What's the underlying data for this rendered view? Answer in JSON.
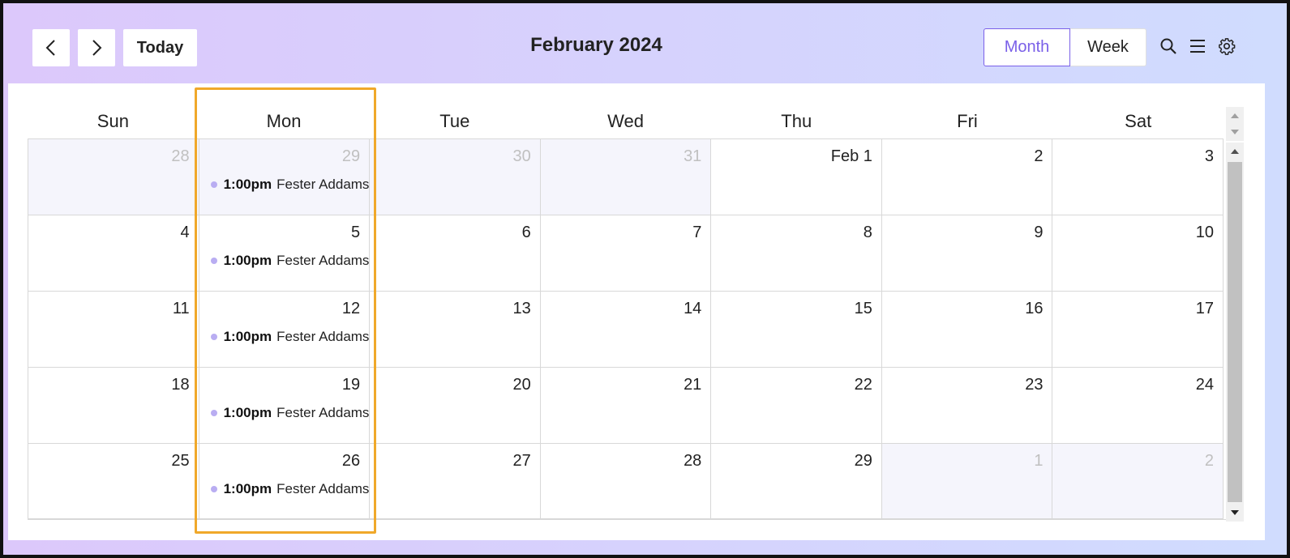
{
  "header": {
    "title": "February 2024",
    "today_label": "Today",
    "views": [
      "Month",
      "Week"
    ],
    "active_view": "Month"
  },
  "colors": {
    "accent": "#7a60e8",
    "event_dot": "#b9adf2",
    "highlight": "#f0a82a"
  },
  "icons": [
    "chevron-left-icon",
    "chevron-right-icon",
    "search-icon",
    "menu-icon",
    "gear-icon"
  ],
  "calendar": {
    "weekdays": [
      "Sun",
      "Mon",
      "Tue",
      "Wed",
      "Thu",
      "Fri",
      "Sat"
    ],
    "weeks": [
      {
        "days": [
          {
            "label": "28",
            "other": true
          },
          {
            "label": "29",
            "other": true
          },
          {
            "label": "30",
            "other": true
          },
          {
            "label": "31",
            "other": true
          },
          {
            "label": "Feb 1",
            "other": false
          },
          {
            "label": "2",
            "other": false
          },
          {
            "label": "3",
            "other": false
          }
        ]
      },
      {
        "days": [
          {
            "label": "4",
            "other": false
          },
          {
            "label": "5",
            "other": false
          },
          {
            "label": "6",
            "other": false
          },
          {
            "label": "7",
            "other": false
          },
          {
            "label": "8",
            "other": false
          },
          {
            "label": "9",
            "other": false
          },
          {
            "label": "10",
            "other": false
          }
        ]
      },
      {
        "days": [
          {
            "label": "11",
            "other": false
          },
          {
            "label": "12",
            "other": false
          },
          {
            "label": "13",
            "other": false
          },
          {
            "label": "14",
            "other": false
          },
          {
            "label": "15",
            "other": false
          },
          {
            "label": "16",
            "other": false
          },
          {
            "label": "17",
            "other": false
          }
        ]
      },
      {
        "days": [
          {
            "label": "18",
            "other": false
          },
          {
            "label": "19",
            "other": false
          },
          {
            "label": "20",
            "other": false
          },
          {
            "label": "21",
            "other": false
          },
          {
            "label": "22",
            "other": false
          },
          {
            "label": "23",
            "other": false
          },
          {
            "label": "24",
            "other": false
          }
        ]
      },
      {
        "days": [
          {
            "label": "25",
            "other": false
          },
          {
            "label": "26",
            "other": false
          },
          {
            "label": "27",
            "other": false
          },
          {
            "label": "28",
            "other": false
          },
          {
            "label": "29",
            "other": false
          },
          {
            "label": "1",
            "other": true
          },
          {
            "label": "2",
            "other": true
          }
        ]
      }
    ],
    "events": [
      {
        "week": 0,
        "day": 1,
        "time": "1:00pm",
        "title": "Fester Addams"
      },
      {
        "week": 1,
        "day": 1,
        "time": "1:00pm",
        "title": "Fester Addams"
      },
      {
        "week": 2,
        "day": 1,
        "time": "1:00pm",
        "title": "Fester Addams"
      },
      {
        "week": 3,
        "day": 1,
        "time": "1:00pm",
        "title": "Fester Addams"
      },
      {
        "week": 4,
        "day": 1,
        "time": "1:00pm",
        "title": "Fester Addams"
      }
    ]
  }
}
